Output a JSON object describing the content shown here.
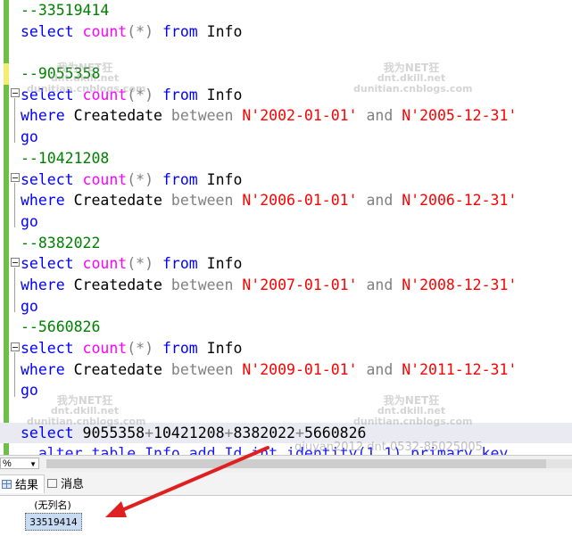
{
  "editor": {
    "lines": [
      {
        "type": "comment",
        "text": "--33519414"
      },
      {
        "type": "select_all",
        "kw1": "select",
        "fn": "count",
        "op": "(*)",
        "kw2": "from",
        "tbl": "Info"
      },
      {
        "type": "blank"
      },
      {
        "type": "comment",
        "text": "--9055358"
      },
      {
        "type": "select_all",
        "kw1": "select",
        "fn": "count",
        "op": "(*)",
        "kw2": "from",
        "tbl": "Info"
      },
      {
        "type": "where",
        "kw": "where",
        "col": "Createdate",
        "between": "between",
        "d1": "N'2002-01-01'",
        "and": "and",
        "d2": "N'2005-12-31'"
      },
      {
        "type": "go",
        "text": "go"
      },
      {
        "type": "comment",
        "text": "--10421208"
      },
      {
        "type": "select_all",
        "kw1": "select",
        "fn": "count",
        "op": "(*)",
        "kw2": "from",
        "tbl": "Info"
      },
      {
        "type": "where",
        "kw": "where",
        "col": "Createdate",
        "between": "between",
        "d1": "N'2006-01-01'",
        "and": "and",
        "d2": "N'2006-12-31'"
      },
      {
        "type": "go",
        "text": "go"
      },
      {
        "type": "comment",
        "text": "--8382022"
      },
      {
        "type": "select_all",
        "kw1": "select",
        "fn": "count",
        "op": "(*)",
        "kw2": "from",
        "tbl": "Info"
      },
      {
        "type": "where",
        "kw": "where",
        "col": "Createdate",
        "between": "between",
        "d1": "N'2007-01-01'",
        "and": "and",
        "d2": "N'2008-12-31'"
      },
      {
        "type": "go",
        "text": "go"
      },
      {
        "type": "comment",
        "text": "--5660826"
      },
      {
        "type": "select_all",
        "kw1": "select",
        "fn": "count",
        "op": "(*)",
        "kw2": "from",
        "tbl": "Info"
      },
      {
        "type": "where",
        "kw": "where",
        "col": "Createdate",
        "between": "between",
        "d1": "N'2009-01-01'",
        "and": "and",
        "d2": "N'2011-12-31'"
      },
      {
        "type": "go",
        "text": "go"
      },
      {
        "type": "blank"
      },
      {
        "type": "sum",
        "kw": "select",
        "expr": [
          "9055358",
          "+",
          "10421208",
          "+",
          "8382022",
          "+",
          "5660826"
        ]
      },
      {
        "type": "partial",
        "text": "  alter table Info add Id int identity(1,1) primary key"
      }
    ]
  },
  "watermarks": [
    {
      "line1": "我为NET狂",
      "line2": "dnt.dkill.net",
      "line3": "dunitian.cnblogs.com"
    },
    {
      "line1": "我为NET狂",
      "line2": "dnt.dkill.net",
      "line3": "dunitian.cnblogs.com"
    },
    {
      "line1": "我为NET狂",
      "line2": "dnt.dkill.net",
      "line3": "dunitian.cnblogs.com"
    },
    {
      "line1": "我为NET狂",
      "line2": "dnt.dkill.net",
      "line3": "dunitian.cnblogs.com"
    }
  ],
  "overlay_text": "qiuyan2012 dnt 0532-85025005",
  "zoom": {
    "value": "%"
  },
  "tabs": [
    {
      "label": "结果",
      "icon": "grid-icon"
    },
    {
      "label": "消息",
      "icon": "message-icon"
    }
  ],
  "results": {
    "column_header": "(无列名)",
    "value": "33519414"
  },
  "colors": {
    "keyword": "#0000ff",
    "function": "#ff00ff",
    "string": "#ff0000",
    "comment": "#008000",
    "arrow": "#e02020",
    "selected_cell": "#c7dbf3"
  }
}
